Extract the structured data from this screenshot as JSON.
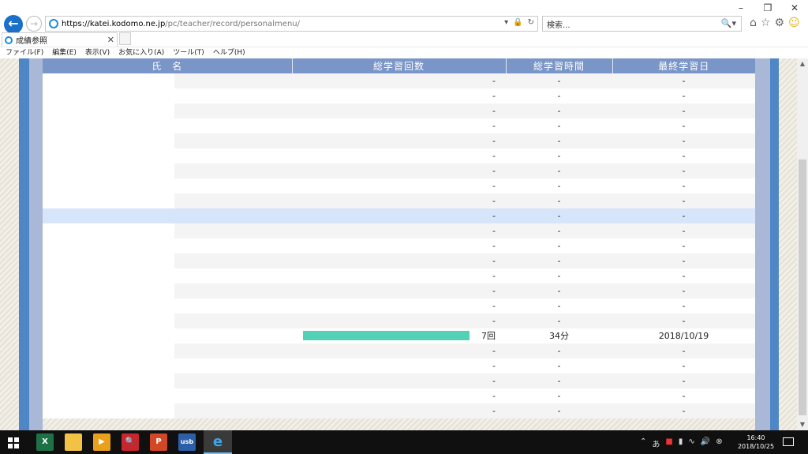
{
  "browser": {
    "url_host": "https://katei.kodomo.ne.jp",
    "url_path": "/pc/teacher/record/personalmenu/",
    "search_placeholder": "検索...",
    "tab_title": "成績参照",
    "menu": [
      "ファイル(F)",
      "編集(E)",
      "表示(V)",
      "お気に入り(A)",
      "ツール(T)",
      "ヘルプ(H)"
    ]
  },
  "table": {
    "headers": [
      "氏　名",
      "総学習回数",
      "総学習時間",
      "最終学習日"
    ],
    "rows": [
      {
        "count": "-",
        "time": "-",
        "date": "-"
      },
      {
        "count": "-",
        "time": "-",
        "date": "-"
      },
      {
        "count": "-",
        "time": "-",
        "date": "-"
      },
      {
        "count": "-",
        "time": "-",
        "date": "-"
      },
      {
        "count": "-",
        "time": "-",
        "date": "-"
      },
      {
        "count": "-",
        "time": "-",
        "date": "-"
      },
      {
        "count": "-",
        "time": "-",
        "date": "-"
      },
      {
        "count": "-",
        "time": "-",
        "date": "-"
      },
      {
        "count": "-",
        "time": "-",
        "date": "-"
      },
      {
        "count": "-",
        "time": "-",
        "date": "-",
        "highlight": true
      },
      {
        "count": "-",
        "time": "-",
        "date": "-"
      },
      {
        "count": "-",
        "time": "-",
        "date": "-"
      },
      {
        "count": "-",
        "time": "-",
        "date": "-"
      },
      {
        "count": "-",
        "time": "-",
        "date": "-"
      },
      {
        "count": "-",
        "time": "-",
        "date": "-"
      },
      {
        "count": "-",
        "time": "-",
        "date": "-"
      },
      {
        "count": "-",
        "time": "-",
        "date": "-"
      },
      {
        "count": "7回",
        "time": "34分",
        "date": "2018/10/19",
        "bar_fraction": 1.0
      },
      {
        "count": "-",
        "time": "-",
        "date": "-"
      },
      {
        "count": "-",
        "time": "-",
        "date": "-"
      },
      {
        "count": "-",
        "time": "-",
        "date": "-"
      },
      {
        "count": "-",
        "time": "-",
        "date": "-"
      },
      {
        "count": "-",
        "time": "-",
        "date": "-"
      }
    ]
  },
  "taskbar": {
    "apps": [
      "excel",
      "file-explorer",
      "media-player",
      "search-app",
      "powerpoint",
      "usb",
      "internet-explorer"
    ],
    "ime_label": "あ",
    "time": "16:40",
    "date": "2018/10/25"
  },
  "colors": {
    "header_bg": "#7a96c8",
    "border_blue": "#4f87c6",
    "bar_color": "#52d1b4",
    "highlight_row": "#d6e5f9"
  }
}
